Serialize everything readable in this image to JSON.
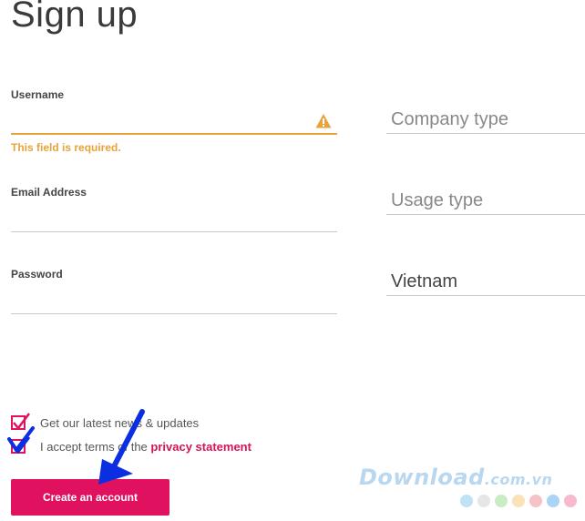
{
  "page": {
    "title": "Sign up"
  },
  "form": {
    "username": {
      "label": "Username",
      "value": "",
      "error": "This field is required."
    },
    "email": {
      "label": "Email Address",
      "value": ""
    },
    "password": {
      "label": "Password",
      "value": ""
    },
    "company_type": {
      "placeholder": "Company type"
    },
    "usage_type": {
      "placeholder": "Usage type"
    },
    "country": {
      "value": "Vietnam"
    }
  },
  "checkboxes": {
    "newsletter": {
      "label": "Get our latest news & updates",
      "checked": true
    },
    "terms": {
      "label_prefix": "I accept terms of the ",
      "link": "privacy statement",
      "checked": true
    }
  },
  "button": {
    "label": "Create an account"
  },
  "watermark": {
    "text": "Download",
    "domain": ".com.vn"
  },
  "colors": {
    "accent": "#e0115f",
    "warning": "#e8a33a",
    "annotation_arrow": "#0a2ee0",
    "watermark": "#b9d7ef",
    "watermark_dots": [
      "#bfe3f5",
      "#e6e6e6",
      "#c9ecc4",
      "#fbe1b8",
      "#f6c2c8",
      "#a9d4f3",
      "#f8b8cf"
    ]
  },
  "icons": {
    "warning": "warning-triangle-icon",
    "check": "checkmark-icon",
    "annotation": "annotation-arrow-icon"
  }
}
